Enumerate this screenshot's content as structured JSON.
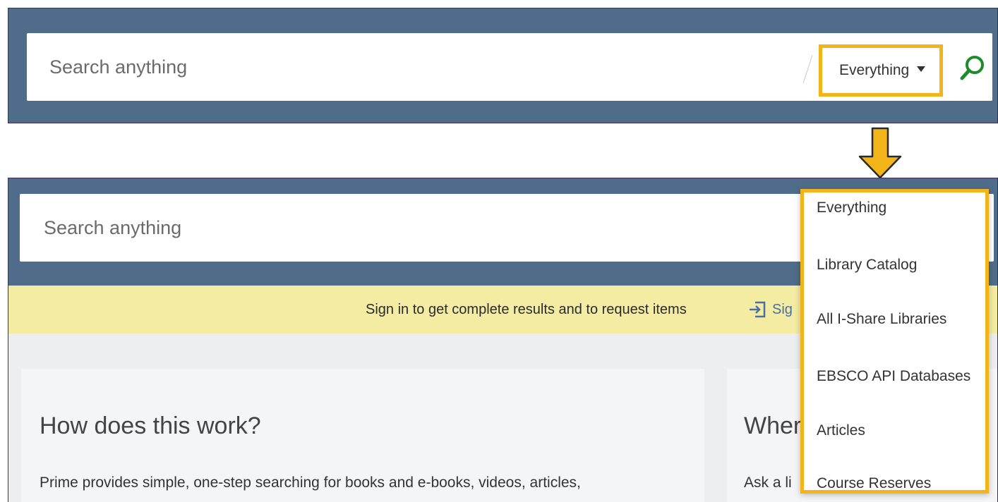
{
  "top": {
    "search_placeholder": "Search anything",
    "scope_selected": "Everything"
  },
  "bottom": {
    "search_placeholder": "Search anything",
    "signin_message": "Sign in to get complete results and to request items",
    "signin_link": "Sig",
    "left_card": {
      "title": "How does this work?",
      "body": "Prime provides simple, one-step searching for books and e-books, videos, articles,"
    },
    "right_card": {
      "title": "Wher",
      "body": "Ask a li"
    },
    "dropdown_options": [
      "Everything",
      "Library Catalog",
      "All I-Share Libraries",
      "EBSCO API Databases",
      "Articles",
      "Course Reserves"
    ]
  },
  "colors": {
    "header_bg": "#4f6d8a",
    "highlight": "#f3b41a",
    "signin_bg": "#f4eca3",
    "search_icon": "#1f8a2c"
  },
  "icons": {
    "search": "search-icon",
    "arrow": "arrow-down-icon",
    "signin": "sign-in-icon",
    "caret": "caret-down-icon"
  }
}
